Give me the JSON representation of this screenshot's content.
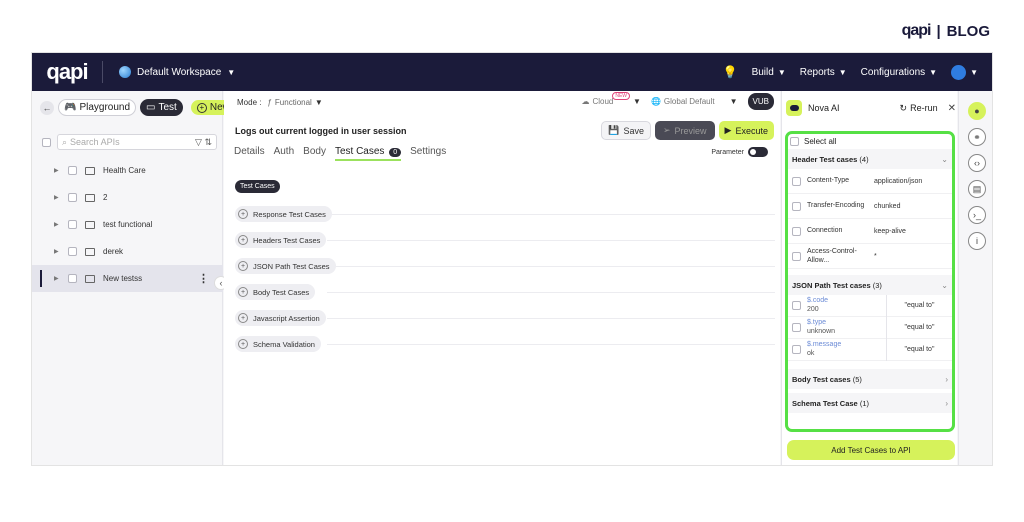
{
  "brand": {
    "logo": "qapi",
    "separator": "|",
    "blog_label": "BLOG"
  },
  "topbar": {
    "logo": "qapi",
    "workspace": "Default Workspace",
    "menus": [
      "Build",
      "Reports",
      "Configurations"
    ]
  },
  "left_panel": {
    "playground_label": "Playground",
    "test_label": "Test",
    "new_label": "New",
    "search_placeholder": "Search APIs",
    "items": [
      {
        "label": "Health Care"
      },
      {
        "label": "2"
      },
      {
        "label": "test functional"
      },
      {
        "label": "derek"
      },
      {
        "label": "New testss"
      }
    ]
  },
  "center": {
    "mode_label": "Mode :",
    "mode_value": "Functional",
    "cloud_label": "Cloud",
    "new_badge": "NEW",
    "env_label": "Global Default",
    "vub_label": "VUB",
    "request_title": "Logs out current logged in user session",
    "save_label": "Save",
    "preview_label": "Preview",
    "execute_label": "Execute",
    "tabs": [
      {
        "label": "Details"
      },
      {
        "label": "Auth"
      },
      {
        "label": "Body"
      },
      {
        "label": "Test Cases",
        "count": "0"
      },
      {
        "label": "Settings"
      }
    ],
    "parameter_label": "Parameter",
    "test_cases_chip": "Test Cases",
    "sections": [
      "Response Test Cases",
      "Headers Test Cases",
      "JSON Path Test Cases",
      "Body Test Cases",
      "Javascript Assertion",
      "Schema Validation"
    ]
  },
  "nova": {
    "title": "Nova AI",
    "rerun_label": "Re-run",
    "select_all": "Select all",
    "header_group": {
      "title": "Header Test cases",
      "count": "(4)"
    },
    "headers": [
      {
        "key": "Content-Type",
        "value": "application/json"
      },
      {
        "key": "Transfer-Encoding",
        "value": "chunked"
      },
      {
        "key": "Connection",
        "value": "keep-alive"
      },
      {
        "key": "Access-Control-Allow...",
        "value": "*"
      }
    ],
    "json_group": {
      "title": "JSON Path Test cases",
      "count": "(3)"
    },
    "json_paths": [
      {
        "path": "$.code",
        "value": "200",
        "op": "\"equal to\""
      },
      {
        "path": "$.type",
        "value": "unknown",
        "op": "\"equal to\""
      },
      {
        "path": "$.message",
        "value": "ok",
        "op": "\"equal to\""
      }
    ],
    "body_group": {
      "title": "Body Test cases",
      "count": "(5)"
    },
    "schema_group": {
      "title": "Schema Test Case",
      "count": "(1)"
    },
    "add_button": "Add Test Cases to API"
  },
  "rail_icons": [
    "nova-ai-icon",
    "link-icon",
    "code-icon",
    "document-icon",
    "terminal-icon",
    "info-icon"
  ]
}
